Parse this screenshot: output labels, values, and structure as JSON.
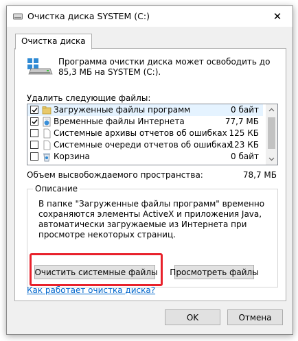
{
  "window": {
    "title": "Очистка диска SYSTEM (C:)",
    "close_glyph": "✕"
  },
  "tab": {
    "label": "Очистка диска"
  },
  "intro": {
    "text": "Программа очистки диска может освободить до 85,3 МБ на SYSTEM (C:)."
  },
  "delete_label": "Удалить следующие файлы:",
  "files": [
    {
      "name": "Загруженные файлы программ",
      "size": "0 байт",
      "checked": true,
      "selected": true,
      "icon": "folder-icon"
    },
    {
      "name": "Временные файлы Интернета",
      "size": "77,7 МБ",
      "checked": true,
      "selected": false,
      "icon": "internet-files-icon"
    },
    {
      "name": "Системные архивы отчетов об ошибках",
      "size": "125 КБ",
      "checked": false,
      "selected": false,
      "icon": "document-icon"
    },
    {
      "name": "Системные очереди отчетов об ошибках",
      "size": "123 КБ",
      "checked": false,
      "selected": false,
      "icon": "document-icon"
    },
    {
      "name": "Корзина",
      "size": "0 байт",
      "checked": false,
      "selected": false,
      "icon": "recycle-bin-icon"
    }
  ],
  "space": {
    "label": "Объем высвобождаемого пространства:",
    "value": "78,7 МБ"
  },
  "description": {
    "title": "Описание",
    "text": "В папке \"Загруженные файлы программ\" временно сохраняются элементы ActiveX и приложения Java, автоматически загружаемые из Интернета при просмотре некоторых страниц."
  },
  "buttons": {
    "cleanup_system": "Очистить системные файлы",
    "view_files": "Просмотреть файлы",
    "ok": "OK",
    "cancel": "Отмена"
  },
  "help_link": "Как работает очистка диска?",
  "colors": {
    "highlight": "#e8212b",
    "link": "#0066cc",
    "selection": "#e5f3ff"
  }
}
